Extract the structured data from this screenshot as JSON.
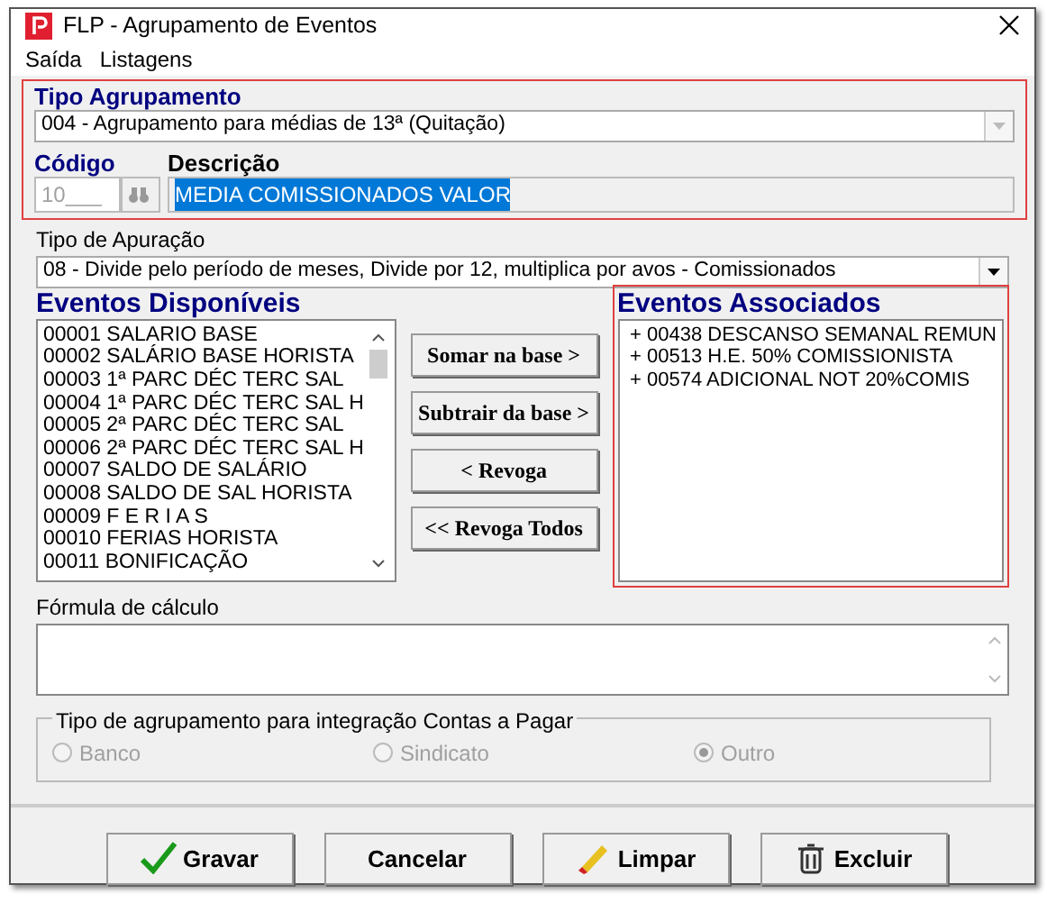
{
  "window": {
    "title": "FLP - Agrupamento de Eventos"
  },
  "menu": [
    "Saída",
    "Listagens"
  ],
  "tipo_agrupamento": {
    "label": "Tipo Agrupamento",
    "value": "004 - Agrupamento para médias de 13ª (Quitação)",
    "disabled": true
  },
  "codigo": {
    "label": "Código",
    "value": "10___",
    "disabled": true
  },
  "descricao": {
    "label": "Descrição",
    "value": "MEDIA COMISSIONADOS VALOR",
    "selected": true
  },
  "tipo_apuracao": {
    "label": "Tipo de Apuração",
    "value": "08 - Divide pelo período de meses, Divide por 12, multiplica por avos - Comissionados"
  },
  "eventos_disponiveis": {
    "title": "Eventos Disponíveis",
    "items": [
      "00001 SALARIO BASE",
      "00002 SALÁRIO BASE HORISTA",
      "00003 1ª PARC DÉC TERC SAL",
      "00004 1ª PARC DÉC TERC SAL H",
      "00005 2ª PARC DÉC TERC SAL",
      "00006 2ª PARC DÉC TERC SAL H",
      "00007 SALDO DE SALÁRIO",
      "00008 SALDO DE SAL HORISTA",
      "00009 F E R I A S",
      "00010 FERIAS HORISTA",
      "00011 BONIFICAÇÃO"
    ]
  },
  "actions": [
    "Somar  na base >",
    "Subtrair da base >",
    "< Revoga",
    "<< Revoga Todos"
  ],
  "eventos_associados": {
    "title": "Eventos Associados",
    "items": [
      "+ 00438 DESCANSO SEMANAL REMUN",
      "+ 00513 H.E. 50% COMISSIONISTA",
      "+ 00574 ADICIONAL NOT 20%COMIS"
    ]
  },
  "formula": {
    "label": "Fórmula de cálculo"
  },
  "integracao": {
    "label": "Tipo de agrupamento para integração Contas a Pagar",
    "disabled": true,
    "options": [
      {
        "label": "Banco",
        "selected": false
      },
      {
        "label": "Sindicato",
        "selected": false
      },
      {
        "label": "Outro",
        "selected": true
      }
    ]
  },
  "buttons": [
    {
      "label": "Gravar",
      "kind": "check"
    },
    {
      "label": "Cancelar",
      "kind": "none"
    },
    {
      "label": "Limpar",
      "kind": "eraser"
    },
    {
      "label": "Excluir",
      "kind": "trash"
    }
  ]
}
